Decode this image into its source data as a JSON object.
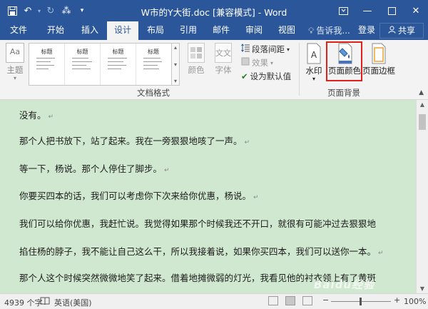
{
  "titlebar": {
    "title": "W市的Y大街.doc [兼容模式] - Word",
    "save_icon": "save-icon",
    "undo_icon": "undo-icon",
    "redo_icon": "redo-icon",
    "touch_icon": "touch-mode-icon",
    "customize_icon": "customize-qat-icon"
  },
  "tabs": [
    {
      "label": "文件"
    },
    {
      "label": "开始"
    },
    {
      "label": "插入"
    },
    {
      "label": "设计",
      "active": true
    },
    {
      "label": "布局"
    },
    {
      "label": "引用"
    },
    {
      "label": "邮件"
    },
    {
      "label": "审阅"
    },
    {
      "label": "视图"
    }
  ],
  "tellme": "告诉我...",
  "login": "登录",
  "share": "共享",
  "ribbon": {
    "theme_label": "主题",
    "theme_icon_text": "Aa",
    "gallery": [
      {
        "title": "标题"
      },
      {
        "title": "标题"
      },
      {
        "title": "标题"
      },
      {
        "title": "标题"
      }
    ],
    "colors_label": "颜色",
    "fonts_label": "字体",
    "fonts_icon_text": "文文",
    "paragraph_spacing": "段落间距",
    "effects": "效果",
    "set_default": "设为默认值",
    "group_document_format": "文档格式",
    "watermark": "水印",
    "page_color": "页面颜色",
    "page_borders": "页面边框",
    "group_page_background": "页面背景"
  },
  "document": {
    "paragraphs": [
      "没有。",
      "那个人把书放下，站了起来。我在一旁狠狠地咳了一声。",
      "等一下，杨说。那个人停住了脚步。",
      "你要买四本的话，我们可以考虑你下次来给你优惠，杨说。",
      "我们可以给你优惠，我赶忙说。我觉得如果那个时候我还不开口，就很有可能冲过去狠狠地",
      "掐住杨的脖子，我不能让自己这么干，所以我接着说，如果你买四本，我们可以送你一本。",
      "那个人这个时候突然微微地笑了起来。借着地摊微弱的灯光，我看见他的衬衣领上有了黄斑"
    ],
    "paragraph_mark": "↵",
    "background_color": "#cfe8cf"
  },
  "statusbar": {
    "words": "4939 个字",
    "language": "英语(美国)",
    "zoom": "100%"
  },
  "colors": {
    "accent": "#2b579a",
    "highlight": "#e0201b"
  },
  "watermark_text": "Baidu经验"
}
